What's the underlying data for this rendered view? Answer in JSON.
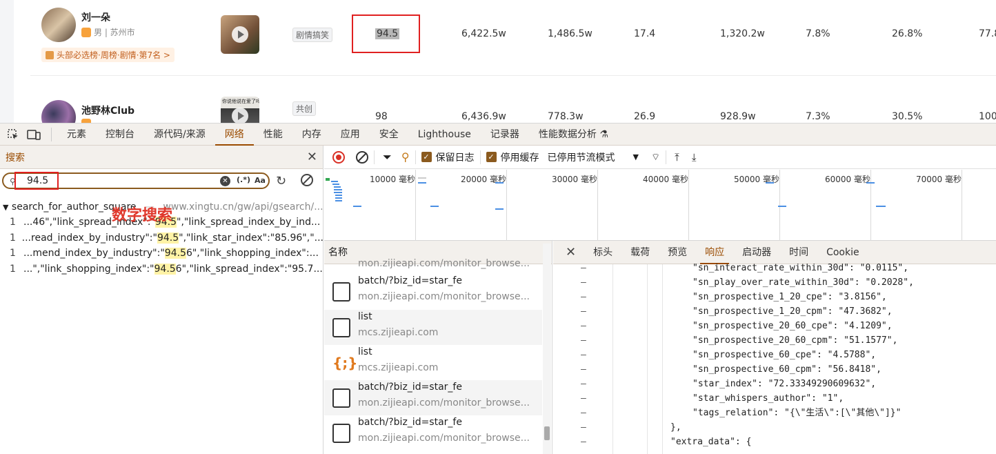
{
  "page": {
    "rows": [
      {
        "name": "刘一朵",
        "meta": "男 | 苏州市",
        "rank": "头部必选榜·周榜·剧情·第7名 >",
        "tag": "剧情搞笑",
        "score": "94.5",
        "followers": "6,422.5w",
        "col3": "1,486.5w",
        "col4": "17.4",
        "col5": "1,320.2w",
        "col6": "7.8%",
        "col7": "26.8%",
        "col8": "77.8"
      },
      {
        "name": "池野林Club",
        "meta": "",
        "rank": "",
        "tag": "共创",
        "score": "98",
        "followers": "6,436.9w",
        "col3": "778.3w",
        "col4": "26.9",
        "col5": "928.9w",
        "col6": "7.3%",
        "col7": "30.5%",
        "col8": "100"
      }
    ],
    "thumb2_caption": "你说他说在爱了吗"
  },
  "devtools": {
    "tabs": [
      "元素",
      "控制台",
      "源代码/来源",
      "网络",
      "性能",
      "内存",
      "应用",
      "安全",
      "Lighthouse",
      "记录器",
      "性能数据分析 ⚗"
    ],
    "active_tab": "网络"
  },
  "search": {
    "title": "搜索",
    "query": "94.5",
    "regex_label": "(.*)",
    "case_label": "Aa",
    "file": {
      "name": "search_for_author_square",
      "url": "www.xingtu.cn/gw/api/gsearch/..."
    },
    "results": [
      {
        "ln": "1",
        "pre": "...46\",\"link_spread_index\":\"",
        "match": "94.5",
        "post": "\",\"link_spread_index_by_ind..."
      },
      {
        "ln": "1",
        "pre": "...read_index_by_industry\":\"",
        "match": "94.5",
        "post": "\",\"link_star_index\":\"85.96\",\"..."
      },
      {
        "ln": "1",
        "pre": "...mend_index_by_industry\":\"",
        "match": "94.5",
        "post": "6\",\"link_shopping_index\":..."
      },
      {
        "ln": "1",
        "pre": "...\",\"link_shopping_index\":\"",
        "match": "94.5",
        "post": "6\",\"link_spread_index\":\"95.7..."
      }
    ],
    "annotation": "数字搜索"
  },
  "network": {
    "preserve_log": "保留日志",
    "disable_cache": "停用缓存",
    "throttle": "已停用节流模式",
    "ticks": [
      "10000 毫秒",
      "20000 毫秒",
      "30000 毫秒",
      "40000 毫秒",
      "50000 毫秒",
      "60000 毫秒",
      "70000 毫秒"
    ],
    "list_header": "名称",
    "requests": [
      {
        "name": "",
        "domain": "mon.zijieapi.com/monitor_browse...",
        "icon": "doc-icon"
      },
      {
        "name": "batch/?biz_id=star_fe",
        "domain": "mon.zijieapi.com/monitor_browse...",
        "icon": "doc-icon"
      },
      {
        "name": "list",
        "domain": "mcs.zijieapi.com",
        "icon": "box-icon"
      },
      {
        "name": "list",
        "domain": "mcs.zijieapi.com",
        "icon": "json-icon"
      },
      {
        "name": "batch/?biz_id=star_fe",
        "domain": "mon.zijieapi.com/monitor_browse...",
        "icon": "doc-icon"
      },
      {
        "name": "batch/?biz_id=star_fe",
        "domain": "mon.zijieapi.com/monitor_browse...",
        "icon": "box-icon"
      }
    ]
  },
  "detail": {
    "tabs": [
      "标头",
      "载荷",
      "预览",
      "响应",
      "启动器",
      "时间",
      "Cookie"
    ],
    "active_tab": "响应",
    "lines": [
      "\"sn_interact_rate_within_30d\": \"0.0115\",",
      "\"sn_play_over_rate_within_30d\": \"0.2028\",",
      "\"sn_prospective_1_20_cpe\": \"3.8156\",",
      "\"sn_prospective_1_20_cpm\": \"47.3682\",",
      "\"sn_prospective_20_60_cpe\": \"4.1209\",",
      "\"sn_prospective_20_60_cpm\": \"51.1577\",",
      "\"sn_prospective_60_cpe\": \"4.5788\",",
      "\"sn_prospective_60_cpm\": \"56.8418\",",
      "\"star_index\": \"72.33349290609632\",",
      "\"star_whispers_author\": \"1\",",
      "\"tags_relation\": \"{\\\"生活\\\":[\\\"其他\\\"]}\"",
      "},",
      "\"extra_data\": {"
    ],
    "dash": "–"
  }
}
